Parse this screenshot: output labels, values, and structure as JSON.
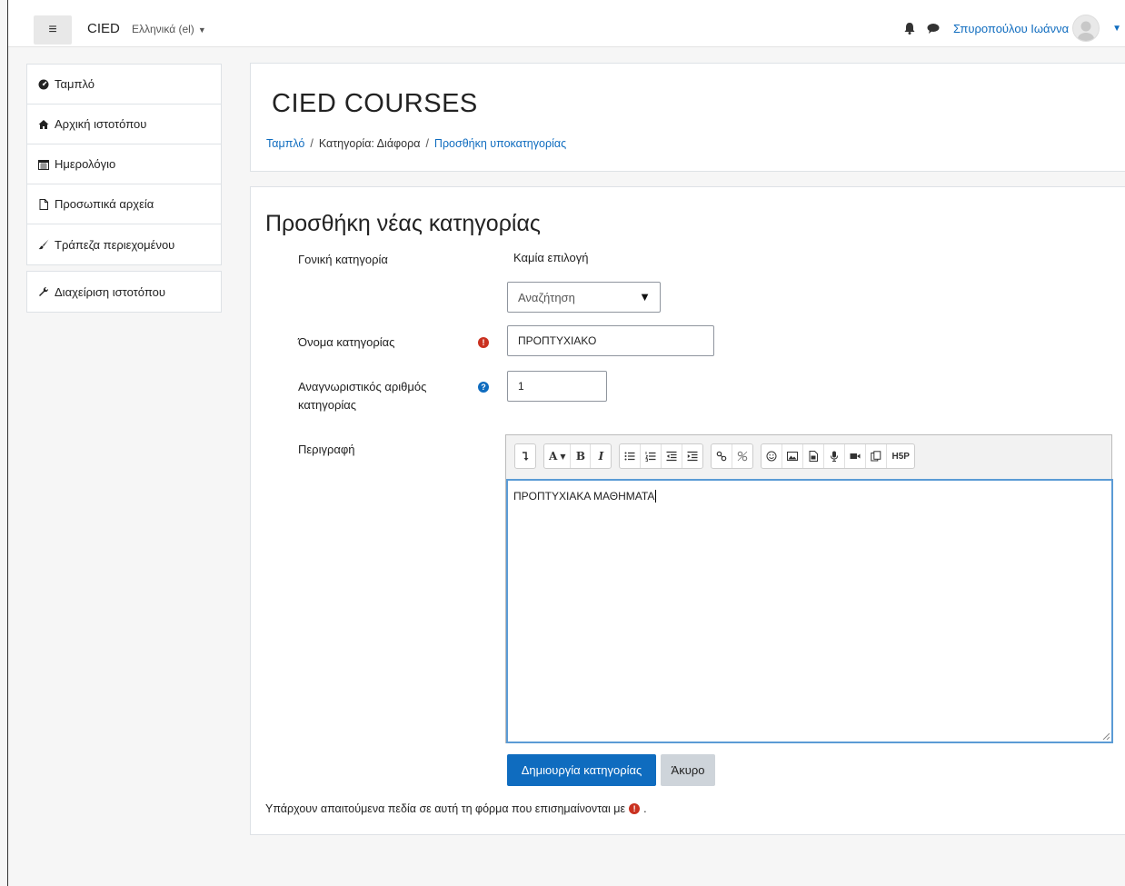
{
  "navbar": {
    "brand": "CIED",
    "language": "Ελληνικά (el)",
    "username": "Σπυροπούλου Ιωάννα"
  },
  "sidebar": {
    "groups": [
      [
        {
          "label": "Ταμπλό",
          "icon": "dashboard-icon"
        },
        {
          "label": "Αρχική ιστοτόπου",
          "icon": "home-icon"
        },
        {
          "label": "Ημερολόγιο",
          "icon": "calendar-icon"
        },
        {
          "label": "Προσωπικά αρχεία",
          "icon": "file-icon"
        },
        {
          "label": "Τράπεζα περιεχομένου",
          "icon": "paintbrush-icon"
        }
      ],
      [
        {
          "label": "Διαχείριση ιστοτόπου",
          "icon": "wrench-icon"
        }
      ]
    ]
  },
  "header": {
    "title": "CIED COURSES",
    "breadcrumb": [
      "Ταμπλό",
      "Κατηγορία: Διάφορα",
      "Προσθήκη υποκατηγορίας"
    ]
  },
  "form": {
    "title": "Προσθήκη νέας κατηγορίας",
    "parent_label": "Γονική κατηγορία",
    "parent_value": "Καμία επιλογή",
    "parent_search": "Αναζήτηση",
    "name_label": "Όνομα κατηγορίας",
    "name_value": "ΠΡΟΠΤΥΧΙΑΚΟ",
    "idnumber_label_line1": "Αναγνωριστικός αριθμός",
    "idnumber_label_line2": "κατηγορίας",
    "idnumber_value": "1",
    "description_label": "Περιγραφή",
    "description_value": "ΠΡΟΠΤΥΧΙΑΚΑ ΜΑΘΗΜΑΤΑ",
    "submit_label": "Δημιουργία κατηγορίας",
    "cancel_label": "Άκυρο",
    "required_note": "Υπάρχουν απαιτούμενα πεδία σε αυτή τη φόρμα που επισημαίνονται με",
    "required_note_end": "."
  },
  "editor_toolbar": {
    "font_size_label": "A",
    "bold_label": "B",
    "italic_label": "I",
    "h5p_label": "H5P"
  },
  "colors": {
    "primary": "#0f6cbf",
    "required": "#ca3120",
    "editor_focus": "#5b9bd5"
  }
}
